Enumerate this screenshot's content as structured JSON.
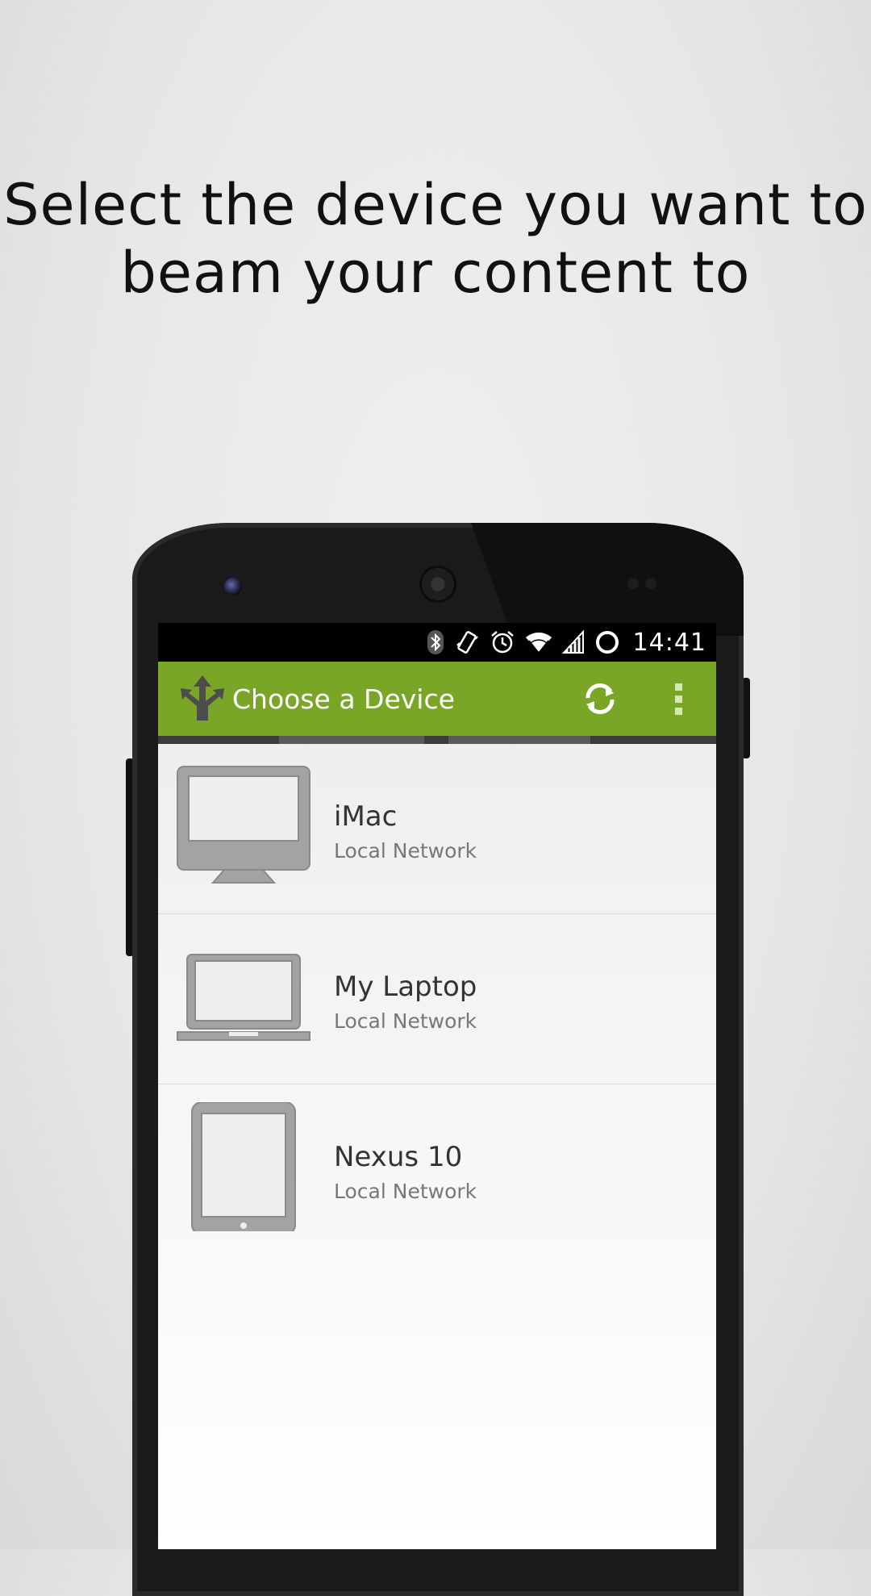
{
  "headline": {
    "line1": "Select the device you want to",
    "line2": "beam your content to"
  },
  "status_bar": {
    "time": "14:41",
    "icons": [
      "bluetooth-icon",
      "vibrate-icon",
      "alarm-icon",
      "wifi-icon",
      "signal-icon",
      "battery-ring-icon"
    ]
  },
  "action_bar": {
    "title": "Choose a Device",
    "color": "#7aa628",
    "actions": [
      "refresh-icon",
      "overflow-menu-icon"
    ]
  },
  "devices": [
    {
      "name": "iMac",
      "network": "Local Network",
      "icon": "desktop-monitor-icon"
    },
    {
      "name": "My Laptop",
      "network": "Local Network",
      "icon": "laptop-icon"
    },
    {
      "name": "Nexus 10",
      "network": "Local Network",
      "icon": "tablet-icon"
    }
  ]
}
